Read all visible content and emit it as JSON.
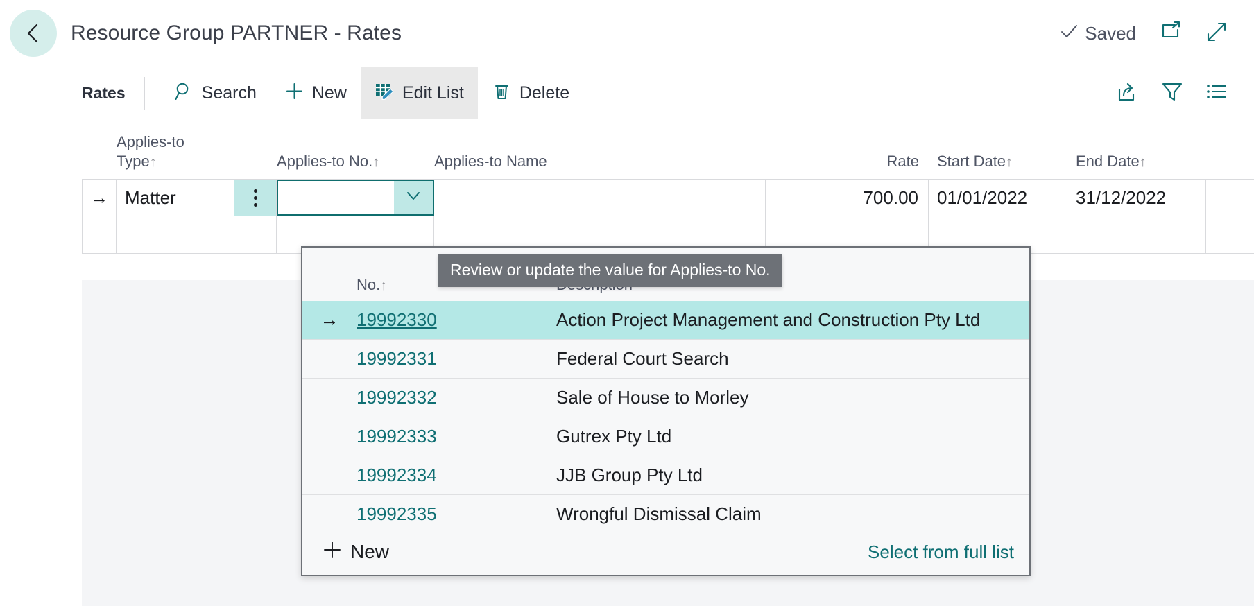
{
  "header": {
    "back_icon": "arrow-left-icon",
    "title": "Resource Group PARTNER - Rates",
    "saved_label": "Saved",
    "check_icon": "check-icon",
    "open_new_window_icon": "open-in-new-window-icon",
    "expand_icon": "expand-full-screen-icon"
  },
  "command_bar": {
    "label": "Rates",
    "items": [
      {
        "label": "Search",
        "icon": "search-icon",
        "active": false
      },
      {
        "label": "New",
        "icon": "plus-icon",
        "active": false
      },
      {
        "label": "Edit List",
        "icon": "edit-list-icon",
        "active": true
      },
      {
        "label": "Delete",
        "icon": "trash-icon",
        "active": false
      }
    ],
    "right_icons": [
      {
        "name": "share-icon"
      },
      {
        "name": "filter-icon"
      },
      {
        "name": "list-options-icon"
      }
    ]
  },
  "grid": {
    "columns": [
      {
        "key": "type",
        "label": "Applies-to\nType",
        "sort": "↑",
        "align": "left"
      },
      {
        "key": "no",
        "label": "Applies-to No.",
        "sort": "↑",
        "align": "left"
      },
      {
        "key": "name",
        "label": "Applies-to Name",
        "sort": "",
        "align": "left"
      },
      {
        "key": "rate",
        "label": "Rate",
        "sort": "",
        "align": "right"
      },
      {
        "key": "start",
        "label": "Start Date",
        "sort": "↑",
        "align": "left"
      },
      {
        "key": "end",
        "label": "End Date",
        "sort": "↑",
        "align": "left"
      }
    ],
    "header_line1": "Applies-to",
    "header_line2": "Type",
    "row": {
      "indicator": "→",
      "type": "Matter",
      "row_menu_icon": "vertical-ellipsis-icon",
      "applies_to_no_value": "",
      "dropdown_chevron_icon": "chevron-down-icon",
      "applies_to_name": "",
      "rate": "700.00",
      "start_date": "01/01/2022",
      "end_date": "31/12/2022"
    }
  },
  "tooltip": {
    "text": "Review or update the value for Applies-to No."
  },
  "dropdown": {
    "columns": {
      "no": "No.",
      "no_sort": "↑",
      "description": "Description"
    },
    "rows": [
      {
        "indicator": "→",
        "no": "19992330",
        "description": "Action Project Management and Construction Pty Ltd",
        "selected": true
      },
      {
        "indicator": "",
        "no": "19992331",
        "description": "Federal Court Search",
        "selected": false
      },
      {
        "indicator": "",
        "no": "19992332",
        "description": "Sale of House to Morley",
        "selected": false
      },
      {
        "indicator": "",
        "no": "19992333",
        "description": "Gutrex Pty Ltd",
        "selected": false
      },
      {
        "indicator": "",
        "no": "19992334",
        "description": "JJB Group Pty Ltd",
        "selected": false
      },
      {
        "indicator": "",
        "no": "19992335",
        "description": "Wrongful Dismissal Claim",
        "selected": false
      }
    ],
    "footer": {
      "new_label": "New",
      "new_icon": "plus-icon",
      "select_full_list_label": "Select from full list"
    }
  },
  "colors": {
    "accent_teal": "#0f6f73",
    "selection_cyan": "#b4e8e6",
    "back_circle": "#d5eeeb",
    "page_bg": "#f4f5f7",
    "tooltip_bg": "#6d7177"
  }
}
